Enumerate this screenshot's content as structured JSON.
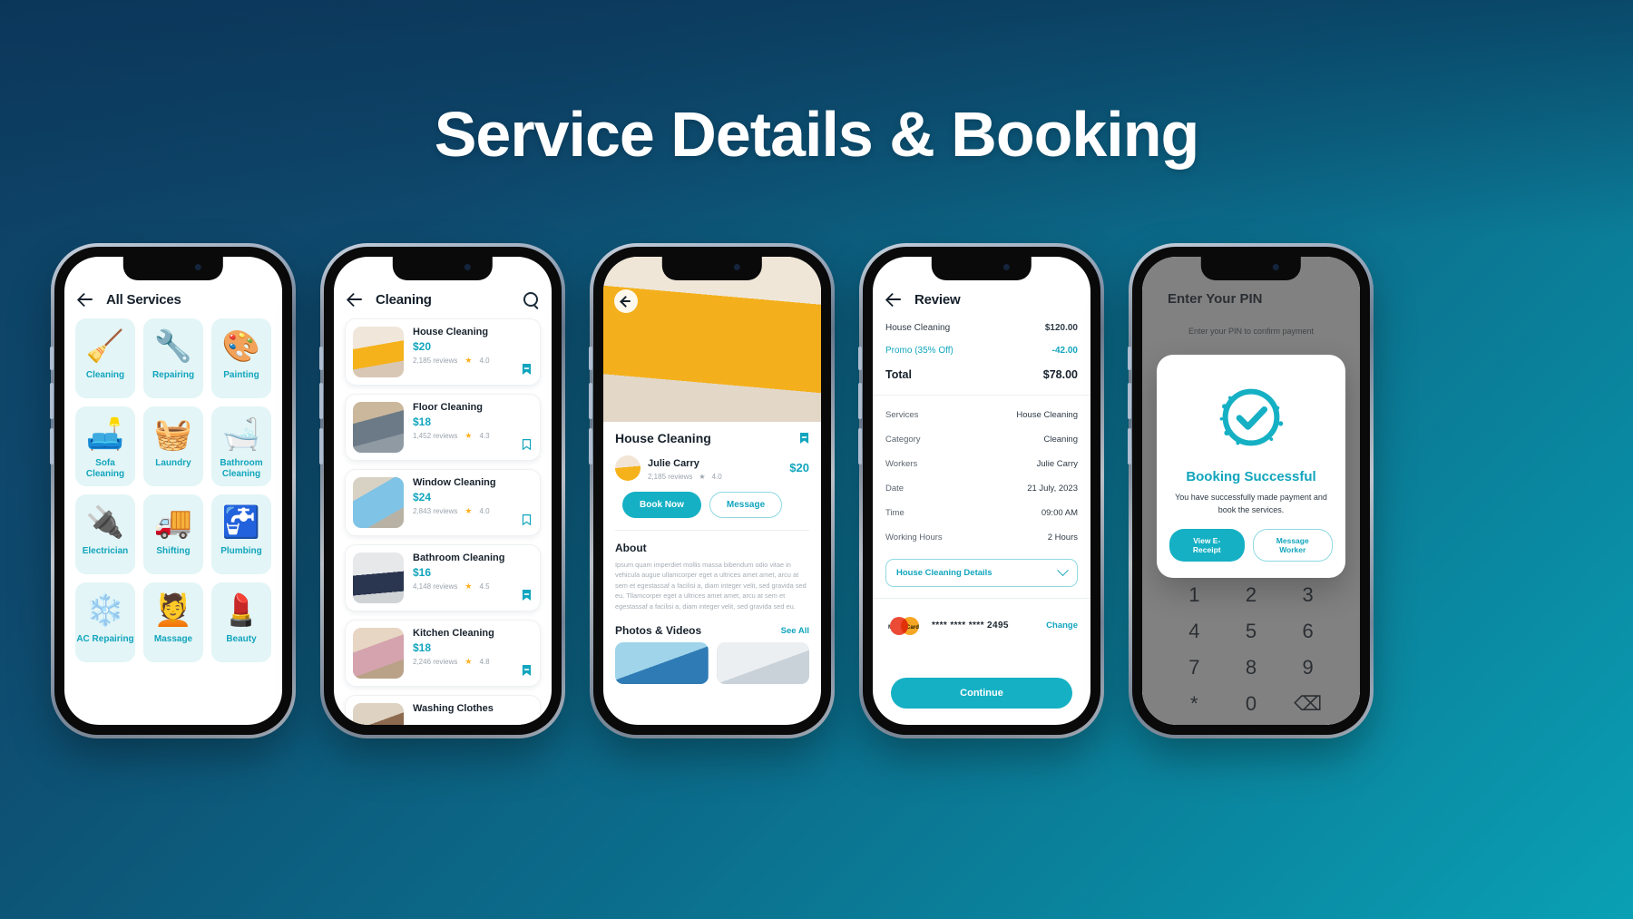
{
  "hero": {
    "title": "Service Details & Booking"
  },
  "colors": {
    "accent": "#12a5bd",
    "accent_fill": "#15b0c4",
    "star": "#ffb020",
    "bg_start": "#0d3f63",
    "bg_end": "#0aa0b4"
  },
  "phone1": {
    "appbar": {
      "title": "All Services",
      "back_icon": "arrow-left-icon"
    },
    "services": [
      {
        "label": "Cleaning",
        "glyph": "🧹"
      },
      {
        "label": "Repairing",
        "glyph": "🔧"
      },
      {
        "label": "Painting",
        "glyph": "🎨"
      },
      {
        "label": "Sofa Cleaning",
        "glyph": "🛋️"
      },
      {
        "label": "Laundry",
        "glyph": "🧺"
      },
      {
        "label": "Bathroom Cleaning",
        "glyph": "🛁"
      },
      {
        "label": "Electrician",
        "glyph": "🔌"
      },
      {
        "label": "Shifting",
        "glyph": "🚚"
      },
      {
        "label": "Plumbing",
        "glyph": "🚰"
      },
      {
        "label": "AC Repairing",
        "glyph": "❄️"
      },
      {
        "label": "Massage",
        "glyph": "💆"
      },
      {
        "label": "Beauty",
        "glyph": "💄"
      }
    ]
  },
  "phone2": {
    "appbar": {
      "title": "Cleaning",
      "back_icon": "arrow-left-icon",
      "search_icon": "search-icon"
    },
    "items": [
      {
        "title": "House Cleaning",
        "price": "$20",
        "reviews": "2,185 reviews",
        "rating": "4.0",
        "img": "img-house",
        "bookmarked": true
      },
      {
        "title": "Floor Cleaning",
        "price": "$18",
        "reviews": "1,452 reviews",
        "rating": "4.3",
        "img": "img-floor",
        "bookmarked": false
      },
      {
        "title": "Window Cleaning",
        "price": "$24",
        "reviews": "2,843 reviews",
        "rating": "4.0",
        "img": "img-window",
        "bookmarked": false
      },
      {
        "title": "Bathroom Cleaning",
        "price": "$16",
        "reviews": "4,148 reviews",
        "rating": "4.5",
        "img": "img-bath",
        "bookmarked": true
      },
      {
        "title": "Kitchen Cleaning",
        "price": "$18",
        "reviews": "2,246 reviews",
        "rating": "4.8",
        "img": "img-kitchen",
        "bookmarked": true
      },
      {
        "title": "Washing Clothes",
        "price": "",
        "reviews": "",
        "rating": "",
        "img": "img-wash",
        "bookmarked": false
      }
    ]
  },
  "phone3": {
    "back_icon": "arrow-left-icon",
    "bookmark_icon": "bookmark-icon",
    "title": "House Cleaning",
    "worker": {
      "name": "Julie Carry",
      "reviews": "2,185 reviews",
      "rating": "4.0",
      "price": "$20"
    },
    "buttons": {
      "book": "Book Now",
      "message": "Message"
    },
    "about": {
      "heading": "About",
      "text": "Ipsum quam imperdiet mollis massa bibendum odio vitae in vehicula augue ullamcorper eget a ultrices amet amet, arcu at sem et egestassaf a  facilisi a, diam integer velit, sed gravida sed eu. Tllamcorper eget a ultrices amet amet, arcu at sem et egestassaf a  facilisi a, diam integer velit, sed gravida sed eu."
    },
    "photos": {
      "heading": "Photos & Videos",
      "see_all": "See All"
    }
  },
  "phone4": {
    "appbar": {
      "title": "Review",
      "back_icon": "arrow-left-icon"
    },
    "summary": [
      {
        "key": "House Cleaning",
        "value": "$120.00",
        "style": "normal"
      },
      {
        "key": "Promo (35% Off)",
        "value": "-42.00",
        "style": "promo"
      },
      {
        "key": "Total",
        "value": "$78.00",
        "style": "total"
      }
    ],
    "details": [
      {
        "key": "Services",
        "value": "House Cleaning"
      },
      {
        "key": "Category",
        "value": "Cleaning"
      },
      {
        "key": "Workers",
        "value": "Julie Carry"
      },
      {
        "key": "Date",
        "value": "21 July, 2023"
      },
      {
        "key": "Time",
        "value": "09:00 AM"
      },
      {
        "key": "Working Hours",
        "value": "2 Hours"
      }
    ],
    "select": {
      "label": "House Cleaning Details",
      "icon": "chevron-down-icon"
    },
    "payment": {
      "brand": "MasterCard",
      "number": "**** **** **** 2495",
      "change": "Change"
    },
    "continue_label": "Continue"
  },
  "phone5": {
    "appbar": {
      "title": "Enter Your PIN",
      "back_icon": "arrow-left-icon"
    },
    "subtitle": "Enter your PIN to confirm payment",
    "keypad": [
      "1",
      "2",
      "3",
      "4",
      "5",
      "6",
      "7",
      "8",
      "9",
      "*",
      "0",
      "⌫"
    ],
    "success": {
      "icon": "check-circle-icon",
      "title": "Booking Successful",
      "text": "You have successfully made payment and book the services.",
      "primary_button": "View E-Receipt",
      "secondary_button": "Message Worker"
    }
  }
}
